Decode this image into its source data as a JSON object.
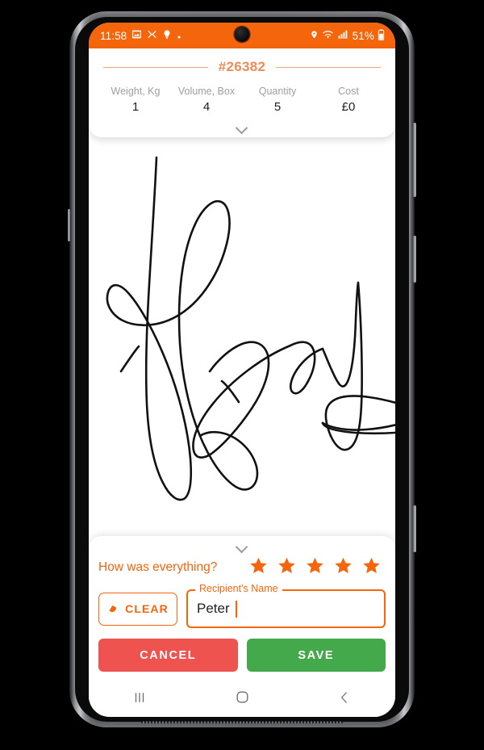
{
  "status_bar": {
    "time": "11:58",
    "battery_percent": "51%",
    "left_icons": [
      "image-icon",
      "crop-icon",
      "bulb-icon",
      "dot-icon"
    ],
    "right_icons": [
      "location-pin-icon",
      "wifi-icon",
      "signal-bars-icon",
      "battery-icon"
    ],
    "background_color": "#f4650c"
  },
  "summary_card": {
    "order_number": "#26382",
    "stats": [
      {
        "label": "Weight, Kg",
        "value": "1"
      },
      {
        "label": "Volume, Box",
        "value": "4"
      },
      {
        "label": "Quantity",
        "value": "5"
      },
      {
        "label": "Cost",
        "value": "£0"
      }
    ],
    "collapse_icon": "chevron-down-icon"
  },
  "signature": {
    "name": "signature-canvas",
    "ink_color": "#111111"
  },
  "bottom_sheet": {
    "handle_icon": "chevron-down-icon",
    "rating_question": "How was everything?",
    "rating_value": 5,
    "rating_max": 5,
    "star_color": "#f4650c",
    "clear_button": {
      "label": "CLEAR",
      "icon": "eraser-icon"
    },
    "name_field": {
      "label": "Recipient's Name",
      "value": "Peter",
      "placeholder": "Recipient's Name"
    },
    "cancel_button": {
      "label": "CANCEL",
      "color": "#ef5350"
    },
    "save_button": {
      "label": "SAVE",
      "color": "#44a94a"
    }
  },
  "nav_bar": {
    "recents_icon": "recents-icon",
    "home_icon": "home-icon",
    "back_icon": "back-icon"
  }
}
